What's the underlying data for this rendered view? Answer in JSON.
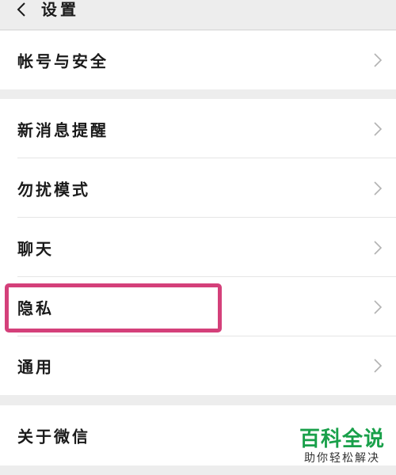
{
  "header": {
    "title": "设置",
    "back_icon": "chevron-left-icon"
  },
  "menu": {
    "account_security": "帐号与安全",
    "new_message_notify": "新消息提醒",
    "do_not_disturb": "勿扰模式",
    "chat": "聊天",
    "privacy": "隐私",
    "general": "通用",
    "about": "关于微信",
    "row_icon": "chevron-right-icon"
  },
  "annotation": {
    "highlight_color": "#d4407a",
    "highlighted_item": "隐私"
  },
  "watermark": {
    "main": "百科全说",
    "sub": "助你轻松解决",
    "color": "#19a04a"
  }
}
